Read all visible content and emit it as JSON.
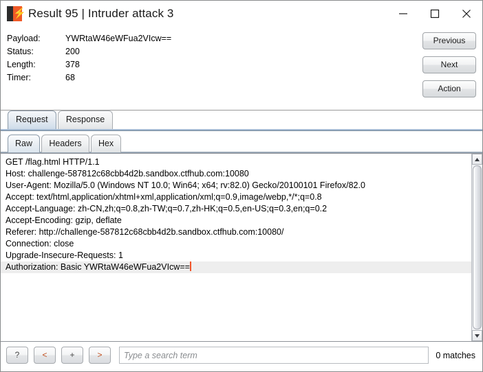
{
  "window": {
    "title": "Result 95 | Intruder attack 3",
    "icon": "burp-suite-icon",
    "minimize_label": "minimize-icon",
    "maximize_label": "maximize-icon",
    "close_label": "close-icon"
  },
  "summary": {
    "rows": [
      {
        "label": "Payload:",
        "value": "YWRtaW46eWFua2VIcw=="
      },
      {
        "label": "Status:",
        "value": "200"
      },
      {
        "label": "Length:",
        "value": "378"
      },
      {
        "label": "Timer:",
        "value": "68"
      }
    ]
  },
  "side_buttons": {
    "previous": "Previous",
    "next": "Next",
    "action": "Action"
  },
  "outer_tabs": [
    {
      "label": "Request",
      "selected": true
    },
    {
      "label": "Response",
      "selected": false
    }
  ],
  "inner_tabs": [
    {
      "label": "Raw",
      "selected": true
    },
    {
      "label": "Headers",
      "selected": false
    },
    {
      "label": "Hex",
      "selected": false
    }
  ],
  "message": {
    "lines": [
      {
        "text": "GET /flag.html HTTP/1.1",
        "highlight": false,
        "caret": false
      },
      {
        "text": "Host: challenge-587812c68cbb4d2b.sandbox.ctfhub.com:10080",
        "highlight": false,
        "caret": false
      },
      {
        "text": "User-Agent: Mozilla/5.0 (Windows NT 10.0; Win64; x64; rv:82.0) Gecko/20100101 Firefox/82.0",
        "highlight": false,
        "caret": false
      },
      {
        "text": "Accept: text/html,application/xhtml+xml,application/xml;q=0.9,image/webp,*/*;q=0.8",
        "highlight": false,
        "caret": false
      },
      {
        "text": "Accept-Language: zh-CN,zh;q=0.8,zh-TW;q=0.7,zh-HK;q=0.5,en-US;q=0.3,en;q=0.2",
        "highlight": false,
        "caret": false
      },
      {
        "text": "Accept-Encoding: gzip, deflate",
        "highlight": false,
        "caret": false
      },
      {
        "text": "Referer: http://challenge-587812c68cbb4d2b.sandbox.ctfhub.com:10080/",
        "highlight": false,
        "caret": false
      },
      {
        "text": "Connection: close",
        "highlight": false,
        "caret": false
      },
      {
        "text": "Upgrade-Insecure-Requests: 1",
        "highlight": false,
        "caret": false
      },
      {
        "text": "Authorization: Basic YWRtaW46eWFua2VIcw==",
        "highlight": true,
        "caret": true
      }
    ]
  },
  "search": {
    "help_label": "?",
    "prev_label": "<",
    "add_label": "+",
    "next_label": ">",
    "placeholder": "Type a search term",
    "value": "",
    "matches": "0 matches"
  },
  "colors": {
    "accent_orange": "#f05a28",
    "caret": "#f0542a",
    "highlight_row": "#eeeeee"
  }
}
